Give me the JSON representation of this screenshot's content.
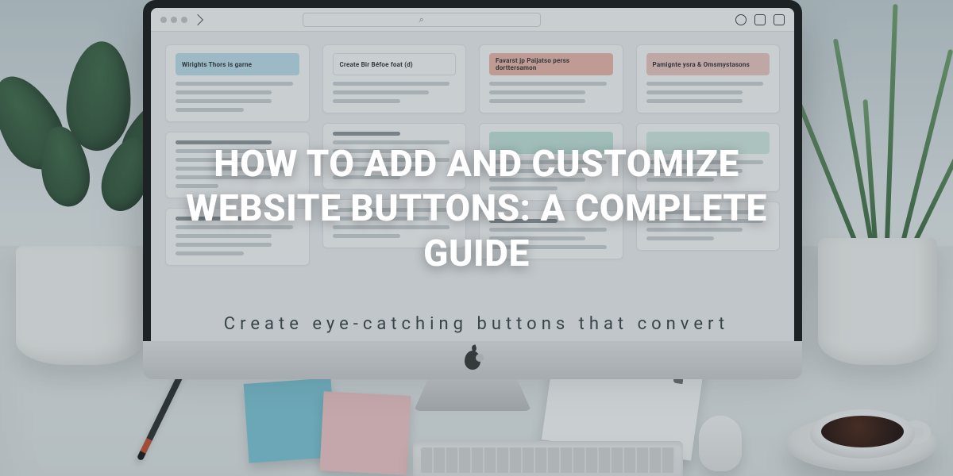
{
  "hero": {
    "title": "HOW TO ADD AND CUSTOMIZE WEBSITE BUTTONS: A COMPLETE GUIDE",
    "subtitle": "Create eye-catching buttons that convert"
  },
  "screen": {
    "search_glyph": "⌕",
    "cards": {
      "c1": "Wirights Thors is garne",
      "c2": "Create Bir Béfoe foat (d)",
      "c3": "Favarst jp Paijatso perss dorttersamon",
      "c4": "Pamignte ysra & Omsmystasons"
    }
  },
  "colors": {
    "head_blue": "#bfe3ef",
    "head_salmon": "#f3b9a9",
    "head_pink": "#f2c9c3",
    "head_teal": "#c7e8e0",
    "head_mint": "#d7efe5"
  }
}
